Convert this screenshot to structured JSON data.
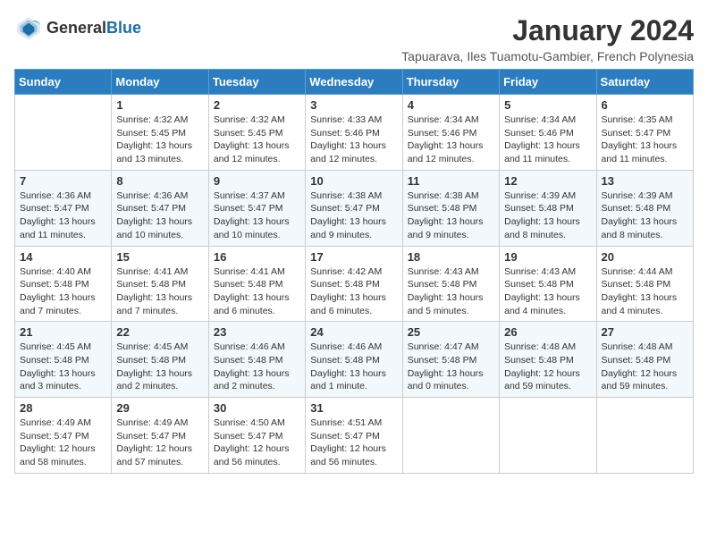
{
  "header": {
    "logo_general": "General",
    "logo_blue": "Blue",
    "month_title": "January 2024",
    "subtitle": "Tapuarava, Iles Tuamotu-Gambier, French Polynesia"
  },
  "weekdays": [
    "Sunday",
    "Monday",
    "Tuesday",
    "Wednesday",
    "Thursday",
    "Friday",
    "Saturday"
  ],
  "weeks": [
    [
      {
        "day": "",
        "info": ""
      },
      {
        "day": "1",
        "info": "Sunrise: 4:32 AM\nSunset: 5:45 PM\nDaylight: 13 hours and 13 minutes."
      },
      {
        "day": "2",
        "info": "Sunrise: 4:32 AM\nSunset: 5:45 PM\nDaylight: 13 hours and 12 minutes."
      },
      {
        "day": "3",
        "info": "Sunrise: 4:33 AM\nSunset: 5:46 PM\nDaylight: 13 hours and 12 minutes."
      },
      {
        "day": "4",
        "info": "Sunrise: 4:34 AM\nSunset: 5:46 PM\nDaylight: 13 hours and 12 minutes."
      },
      {
        "day": "5",
        "info": "Sunrise: 4:34 AM\nSunset: 5:46 PM\nDaylight: 13 hours and 11 minutes."
      },
      {
        "day": "6",
        "info": "Sunrise: 4:35 AM\nSunset: 5:47 PM\nDaylight: 13 hours and 11 minutes."
      }
    ],
    [
      {
        "day": "7",
        "info": "Sunrise: 4:36 AM\nSunset: 5:47 PM\nDaylight: 13 hours and 11 minutes."
      },
      {
        "day": "8",
        "info": "Sunrise: 4:36 AM\nSunset: 5:47 PM\nDaylight: 13 hours and 10 minutes."
      },
      {
        "day": "9",
        "info": "Sunrise: 4:37 AM\nSunset: 5:47 PM\nDaylight: 13 hours and 10 minutes."
      },
      {
        "day": "10",
        "info": "Sunrise: 4:38 AM\nSunset: 5:47 PM\nDaylight: 13 hours and 9 minutes."
      },
      {
        "day": "11",
        "info": "Sunrise: 4:38 AM\nSunset: 5:48 PM\nDaylight: 13 hours and 9 minutes."
      },
      {
        "day": "12",
        "info": "Sunrise: 4:39 AM\nSunset: 5:48 PM\nDaylight: 13 hours and 8 minutes."
      },
      {
        "day": "13",
        "info": "Sunrise: 4:39 AM\nSunset: 5:48 PM\nDaylight: 13 hours and 8 minutes."
      }
    ],
    [
      {
        "day": "14",
        "info": "Sunrise: 4:40 AM\nSunset: 5:48 PM\nDaylight: 13 hours and 7 minutes."
      },
      {
        "day": "15",
        "info": "Sunrise: 4:41 AM\nSunset: 5:48 PM\nDaylight: 13 hours and 7 minutes."
      },
      {
        "day": "16",
        "info": "Sunrise: 4:41 AM\nSunset: 5:48 PM\nDaylight: 13 hours and 6 minutes."
      },
      {
        "day": "17",
        "info": "Sunrise: 4:42 AM\nSunset: 5:48 PM\nDaylight: 13 hours and 6 minutes."
      },
      {
        "day": "18",
        "info": "Sunrise: 4:43 AM\nSunset: 5:48 PM\nDaylight: 13 hours and 5 minutes."
      },
      {
        "day": "19",
        "info": "Sunrise: 4:43 AM\nSunset: 5:48 PM\nDaylight: 13 hours and 4 minutes."
      },
      {
        "day": "20",
        "info": "Sunrise: 4:44 AM\nSunset: 5:48 PM\nDaylight: 13 hours and 4 minutes."
      }
    ],
    [
      {
        "day": "21",
        "info": "Sunrise: 4:45 AM\nSunset: 5:48 PM\nDaylight: 13 hours and 3 minutes."
      },
      {
        "day": "22",
        "info": "Sunrise: 4:45 AM\nSunset: 5:48 PM\nDaylight: 13 hours and 2 minutes."
      },
      {
        "day": "23",
        "info": "Sunrise: 4:46 AM\nSunset: 5:48 PM\nDaylight: 13 hours and 2 minutes."
      },
      {
        "day": "24",
        "info": "Sunrise: 4:46 AM\nSunset: 5:48 PM\nDaylight: 13 hours and 1 minute."
      },
      {
        "day": "25",
        "info": "Sunrise: 4:47 AM\nSunset: 5:48 PM\nDaylight: 13 hours and 0 minutes."
      },
      {
        "day": "26",
        "info": "Sunrise: 4:48 AM\nSunset: 5:48 PM\nDaylight: 12 hours and 59 minutes."
      },
      {
        "day": "27",
        "info": "Sunrise: 4:48 AM\nSunset: 5:48 PM\nDaylight: 12 hours and 59 minutes."
      }
    ],
    [
      {
        "day": "28",
        "info": "Sunrise: 4:49 AM\nSunset: 5:47 PM\nDaylight: 12 hours and 58 minutes."
      },
      {
        "day": "29",
        "info": "Sunrise: 4:49 AM\nSunset: 5:47 PM\nDaylight: 12 hours and 57 minutes."
      },
      {
        "day": "30",
        "info": "Sunrise: 4:50 AM\nSunset: 5:47 PM\nDaylight: 12 hours and 56 minutes."
      },
      {
        "day": "31",
        "info": "Sunrise: 4:51 AM\nSunset: 5:47 PM\nDaylight: 12 hours and 56 minutes."
      },
      {
        "day": "",
        "info": ""
      },
      {
        "day": "",
        "info": ""
      },
      {
        "day": "",
        "info": ""
      }
    ]
  ]
}
